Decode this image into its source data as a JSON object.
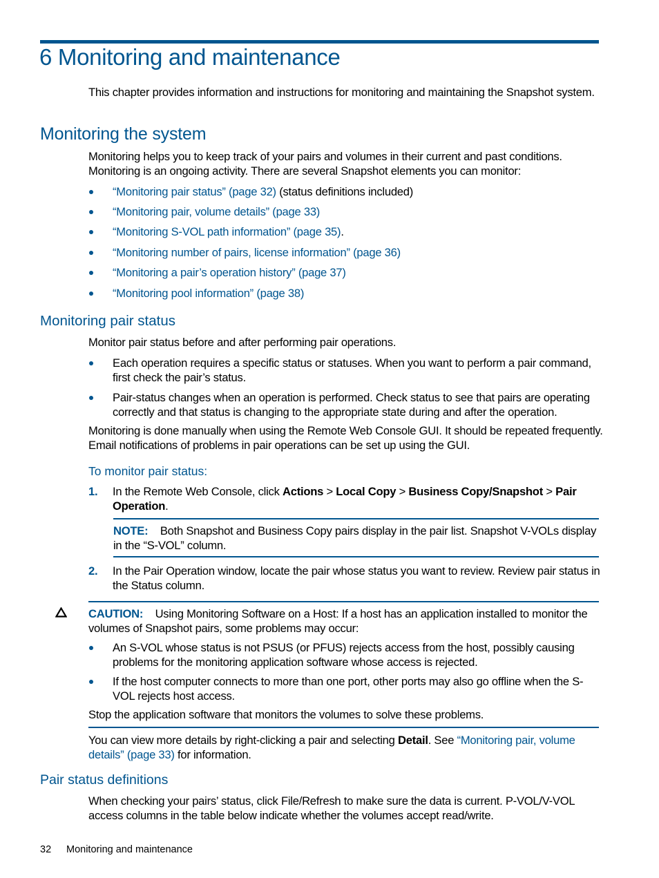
{
  "chapter": {
    "title": "6 Monitoring and maintenance",
    "intro": "This chapter provides information and instructions for monitoring and maintaining the Snapshot system."
  },
  "monitoring_system": {
    "heading": "Monitoring the system",
    "paragraph": "Monitoring helps you to keep track of your pairs and volumes in their current and past conditions. Monitoring is an ongoing activity. There are several Snapshot elements you can monitor:",
    "links": [
      {
        "link": "“Monitoring pair status” (page 32)",
        "suffix": " (status definitions included)"
      },
      {
        "link": "“Monitoring pair, volume details” (page 33)",
        "suffix": ""
      },
      {
        "link": "“Monitoring S-VOL path information” (page 35)",
        "suffix": "."
      },
      {
        "link": "“Monitoring number of pairs, license information” (page 36)",
        "suffix": ""
      },
      {
        "link": "“Monitoring a pair’s operation history” (page 37)",
        "suffix": ""
      },
      {
        "link": "“Monitoring pool information” (page 38)",
        "suffix": ""
      }
    ]
  },
  "pair_status": {
    "heading": "Monitoring pair status",
    "intro": "Monitor pair status before and after performing pair operations.",
    "bullets": [
      "Each operation requires a specific status or statuses. When you want to perform a pair command, first check the pair’s status.",
      "Pair-status changes when an operation is performed. Check status to see that pairs are operating correctly and that status is changing to the appropriate state during and after the operation."
    ],
    "manual": "Monitoring is done manually when using the Remote Web Console GUI. It should be repeated frequently. Email notifications of problems in pair operations can be set up using the GUI.",
    "procedure_heading": "To monitor pair status:",
    "step1": {
      "num": "1.",
      "pre": "In the Remote Web Console, click ",
      "actions": "Actions",
      "sep": " > ",
      "local_copy": "Local Copy",
      "bc_snapshot": "Business Copy/Snapshot",
      "pair_operation": "Pair Operation",
      "end": "."
    },
    "note": {
      "label": "NOTE:",
      "text": "Both Snapshot and Business Copy pairs display in the pair list. Snapshot V-VOLs display in the “S-VOL” column."
    },
    "step2": {
      "num": "2.",
      "text": "In the Pair Operation window, locate the pair whose status you want to review. Review pair status in the Status column."
    },
    "caution": {
      "icon": "△",
      "label": "CAUTION:",
      "text": "Using Monitoring Software on a Host: If a host has an application installed to monitor the volumes of Snapshot pairs, some problems may occur:",
      "bullets": [
        "An S-VOL whose status is not PSUS (or PFUS) rejects access from the host, possibly causing problems for the monitoring application software whose access is rejected.",
        "If the host computer connects to more than one port, other ports may also go offline when the S-VOL rejects host access."
      ],
      "closing": "Stop the application software that monitors the volumes to solve these problems."
    },
    "details": {
      "pre": "You can view more details by right-clicking a pair and selecting ",
      "bold": "Detail",
      "mid": ". See ",
      "link": "“Monitoring pair, volume details” (page 33)",
      "post": " for information."
    }
  },
  "definitions": {
    "heading": "Pair status definitions",
    "text": "When checking your pairs’ status, click File/Refresh to make sure the data is current. P-VOL/V-VOL access columns in the table below indicate whether the volumes accept read/write."
  },
  "footer": {
    "page_number": "32",
    "section": "Monitoring and maintenance"
  },
  "colors": {
    "accent": "#00558f",
    "text": "#000000"
  }
}
